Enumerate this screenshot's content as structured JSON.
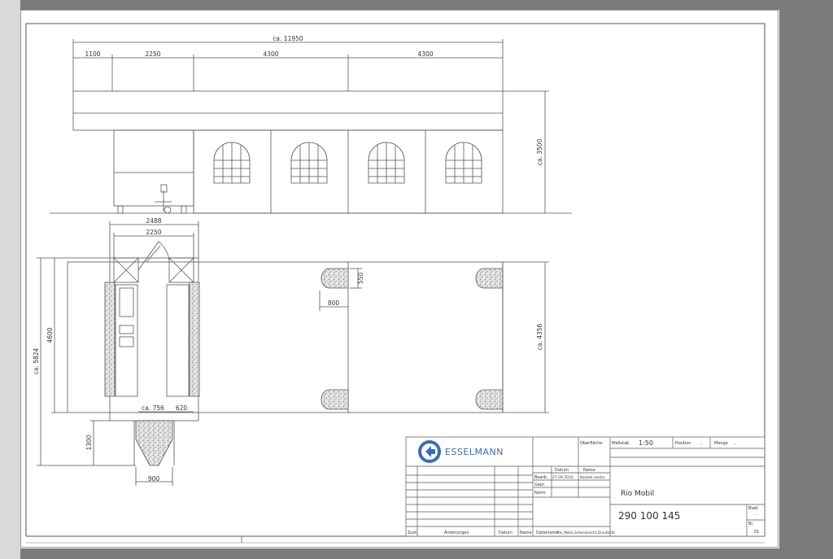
{
  "drawing": {
    "dimensions": {
      "total_length": "ca. 11950",
      "seg1": "1100",
      "seg2": "2250",
      "seg3": "4300",
      "seg4": "4300",
      "height": "ca. 3500",
      "vehicle_outer_width": "2488",
      "vehicle_inner_width": "2250",
      "total_depth": "ca. 5824",
      "vehicle_depth": "4600",
      "drawbar_length": "1300",
      "drawbar_width": "900",
      "tent_depth": "ca. 4356",
      "base_width": "800",
      "base_depth": "550",
      "counter_left": "ca. 756",
      "counter_right": "620"
    }
  },
  "title_block": {
    "logo_text": "ESSELMANN",
    "labels": {
      "surface": "Oberfläche",
      "scale": "Maßstab",
      "position": "Position",
      "quantity": "Menge",
      "date": "Datum",
      "name": "Name",
      "drawn": "Bearb.",
      "checked": "Gepr.",
      "norm": "Norm",
      "status": "Zust.",
      "changes": "Änderungen",
      "date2": "Datum",
      "name2": "Name",
      "file_name": "Dateiname",
      "sheet": "Blatt",
      "of": "Bl."
    },
    "values": {
      "scale": "1:50",
      "position": "-",
      "quantity": "-",
      "drawn_date": "27.09.2016",
      "drawn_by": "Koszek sasha",
      "file_name": "Rio_Mobil_Seitenansicht_Draufsicht",
      "title": "Rio Mobil",
      "drawing_number": "290 100 145",
      "sheet_no": "-",
      "sheet_total": "01"
    }
  },
  "colors": {
    "line": "#555555",
    "fill_gravel": "#9a9a9a",
    "brand_blue": "#3a6db5",
    "frame_bg": "#7b7b7b"
  }
}
